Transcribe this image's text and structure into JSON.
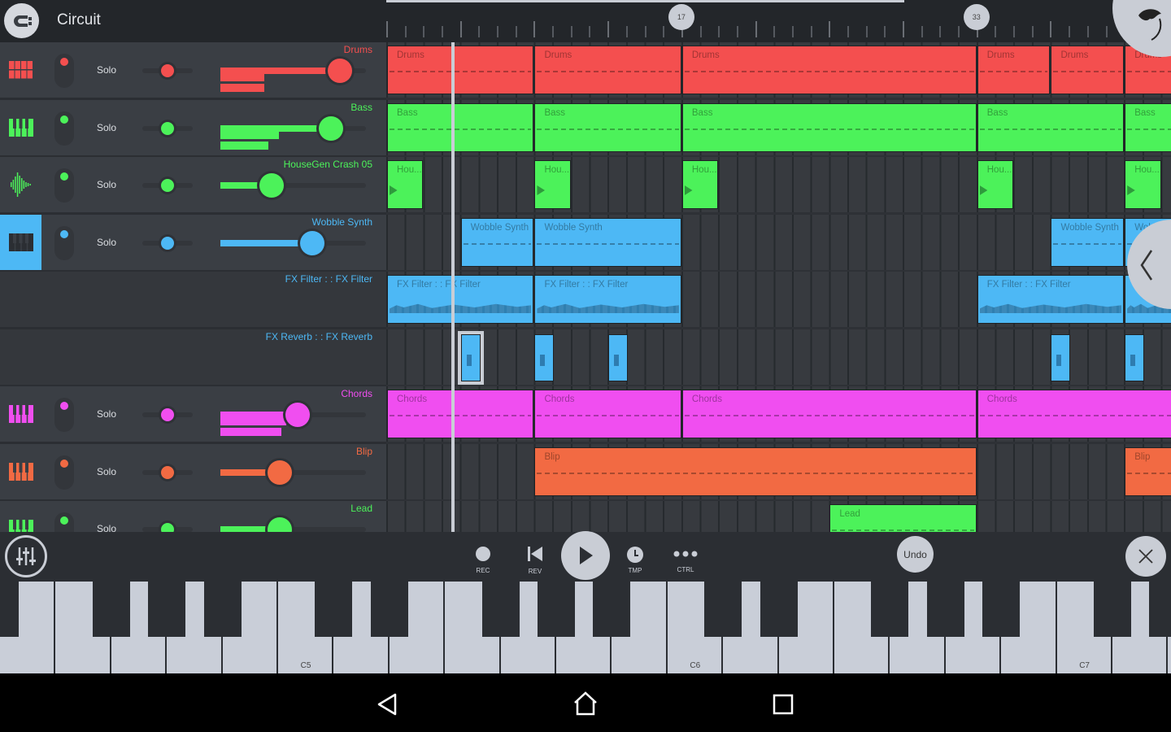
{
  "header": {
    "title": "Circuit",
    "logo_icon": "circuit-logo-icon"
  },
  "timeline": {
    "visible_bars": [
      1,
      43.5
    ],
    "bar_labels": [
      "17",
      "33"
    ],
    "playhead_bar": 4.6,
    "song_progress_fraction": 0.66
  },
  "tracks": [
    {
      "name": "Drums",
      "color": "#f44f4f",
      "icon": "drum-pads-icon",
      "solo": "Solo",
      "pan": 0.5,
      "volume": 0.82,
      "meter": [
        0.3,
        0.3
      ],
      "selected": false,
      "clips": [
        {
          "label": "Drums",
          "start": 1,
          "length": 8
        },
        {
          "label": "Drums",
          "start": 9,
          "length": 8
        },
        {
          "label": "Drums",
          "start": 17,
          "length": 16
        },
        {
          "label": "Drums",
          "start": 33,
          "length": 4
        },
        {
          "label": "Drums",
          "start": 37,
          "length": 4
        },
        {
          "label": "Drums",
          "start": 41,
          "length": 4
        }
      ]
    },
    {
      "name": "Bass",
      "color": "#4cf25a",
      "icon": "piano-keys-icon",
      "solo": "Solo",
      "pan": 0.5,
      "volume": 0.76,
      "meter": [
        0.4,
        0.33
      ],
      "selected": false,
      "clips": [
        {
          "label": "Bass",
          "start": 1,
          "length": 8
        },
        {
          "label": "Bass",
          "start": 9,
          "length": 8
        },
        {
          "label": "Bass",
          "start": 17,
          "length": 16
        },
        {
          "label": "Bass",
          "start": 33,
          "length": 8
        },
        {
          "label": "Bass",
          "start": 41,
          "length": 4
        }
      ]
    },
    {
      "name": "HouseGen Crash 05",
      "color": "#4cf25a",
      "icon": "waveform-icon",
      "solo": "Solo",
      "pan": 0.5,
      "volume": 0.35,
      "meter": [],
      "selected": false,
      "clips": [
        {
          "label": "Hou...",
          "start": 1,
          "length": 2
        },
        {
          "label": "Hou...",
          "start": 9,
          "length": 2
        },
        {
          "label": "Hou...",
          "start": 17,
          "length": 2
        },
        {
          "label": "Hou...",
          "start": 33,
          "length": 2
        },
        {
          "label": "Hou...",
          "start": 41,
          "length": 2
        }
      ]
    },
    {
      "name": "Wobble Synth",
      "color": "#4db8f5",
      "icon": "piano-keys-icon",
      "solo": "Solo",
      "pan": 0.5,
      "volume": 0.63,
      "meter": [],
      "selected": true,
      "clips": [
        {
          "label": "Wobble Synth",
          "start": 5,
          "length": 4
        },
        {
          "label": "Wobble Synth",
          "start": 9,
          "length": 8
        },
        {
          "label": "Wobble Synth",
          "start": 37,
          "length": 4
        },
        {
          "label": "Wobble Synth",
          "start": 41,
          "length": 4
        }
      ]
    },
    {
      "name": "FX Filter :  : FX Filter",
      "color": "#4db8f5",
      "automation": true,
      "clips": [
        {
          "label": "FX Filter :  : FX Filter",
          "start": 1,
          "length": 8
        },
        {
          "label": "FX Filter :  : FX Filter",
          "start": 9,
          "length": 8
        },
        {
          "label": "FX Filter :  : FX Filter",
          "start": 33,
          "length": 8
        },
        {
          "label": "FX Filter :  : FX Filter",
          "start": 41,
          "length": 4
        }
      ]
    },
    {
      "name": "FX Reverb :  : FX Reverb",
      "color": "#4db8f5",
      "automation": true,
      "clips": [
        {
          "label": "",
          "start": 5,
          "length": 1,
          "selected": true
        },
        {
          "label": "",
          "start": 9,
          "length": 1
        },
        {
          "label": "",
          "start": 13,
          "length": 1
        },
        {
          "label": "",
          "start": 37,
          "length": 1
        },
        {
          "label": "",
          "start": 41,
          "length": 1
        }
      ]
    },
    {
      "name": "Chords",
      "color": "#f04ef0",
      "icon": "piano-keys-icon",
      "solo": "Solo",
      "pan": 0.5,
      "volume": 0.53,
      "meter": [
        0.45,
        0.42
      ],
      "selected": false,
      "clips": [
        {
          "label": "Chords",
          "start": 1,
          "length": 8
        },
        {
          "label": "Chords",
          "start": 9,
          "length": 8
        },
        {
          "label": "Chords",
          "start": 17,
          "length": 16
        },
        {
          "label": "Chords",
          "start": 33,
          "length": 16
        }
      ]
    },
    {
      "name": "Blip",
      "color": "#f26a43",
      "icon": "piano-keys-icon",
      "solo": "Solo",
      "pan": 0.5,
      "volume": 0.41,
      "meter": [],
      "selected": false,
      "clips": [
        {
          "label": "Blip",
          "start": 9,
          "length": 24
        },
        {
          "label": "Blip",
          "start": 41,
          "length": 4
        }
      ]
    },
    {
      "name": "Lead",
      "color": "#4cf25a",
      "icon": "piano-keys-icon",
      "solo": "Solo",
      "pan": 0.5,
      "volume": 0.41,
      "meter": [],
      "selected": false,
      "clips": [
        {
          "label": "Lead",
          "start": 25,
          "length": 8
        }
      ]
    }
  ],
  "transport": {
    "rec": "REC",
    "rev": "REV",
    "tmp": "TMP",
    "ctrl": "CTRL",
    "undo": "Undo",
    "mixer_icon": "mixer-icon",
    "close_icon": "close-icon",
    "play_icon": "play-icon"
  },
  "keyboard": {
    "first_key": "E4",
    "labels": [
      "C5",
      "C6",
      "C7"
    ]
  },
  "nav": {
    "back": "back-icon",
    "home": "home-icon",
    "recents": "recents-icon"
  }
}
